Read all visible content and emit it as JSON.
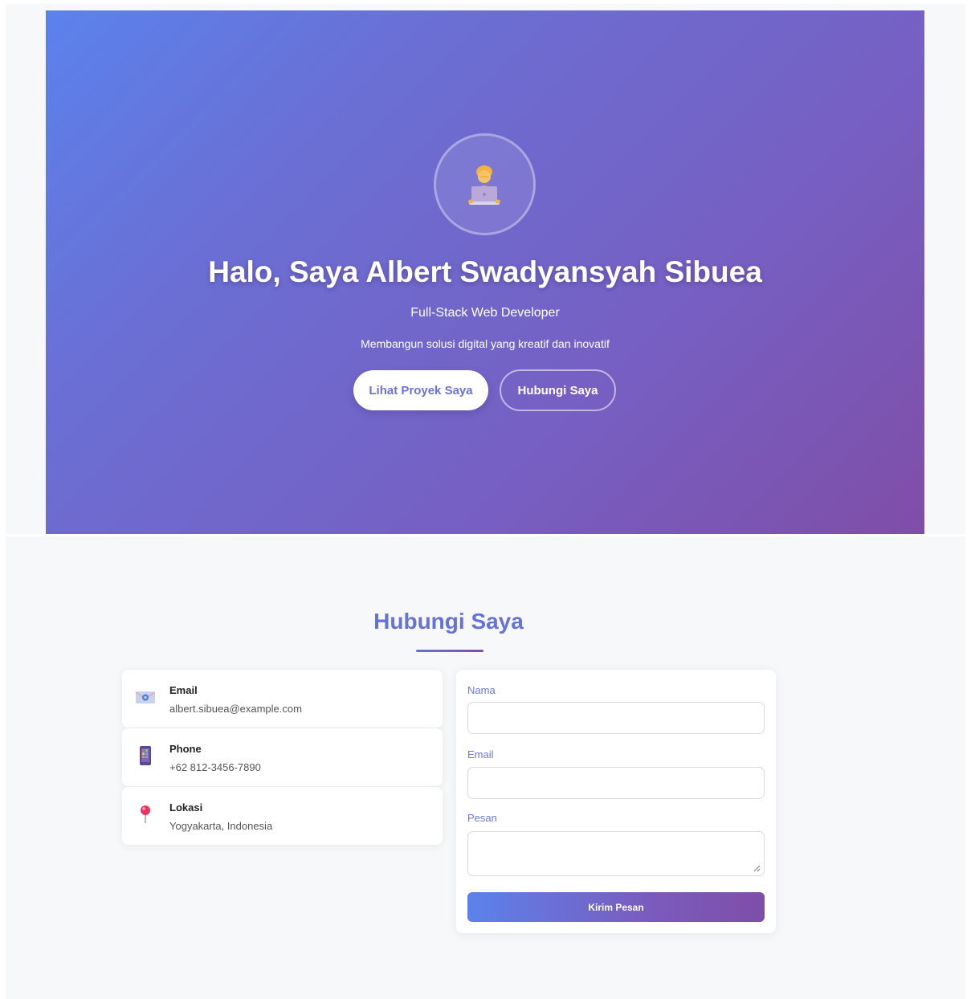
{
  "hero": {
    "avatar_icon": "developer-at-laptop-emoji-icon",
    "title": "Halo, Saya Albert Swadyansyah Sibuea",
    "subtitle": "Full-Stack Web Developer",
    "tagline": "Membangun solusi digital yang kreatif dan inovatif",
    "primary_button": "Lihat Proyek Saya",
    "secondary_button": "Hubungi Saya",
    "gradient_start": "#5b82ec",
    "gradient_end": "#7f4ea8"
  },
  "contact": {
    "title": "Hubungi Saya",
    "info": [
      {
        "icon": "email-envelope-icon",
        "label": "Email",
        "value": "albert.sibuea@example.com"
      },
      {
        "icon": "mobile-phone-icon",
        "label": "Phone",
        "value": "+62 812-3456-7890"
      },
      {
        "icon": "location-pin-icon",
        "label": "Lokasi",
        "value": "Yogyakarta, Indonesia"
      }
    ],
    "form": {
      "name_label": "Nama",
      "name_value": "",
      "email_label": "Email",
      "email_value": "",
      "message_label": "Pesan",
      "message_value": "",
      "submit_label": "Kirim Pesan"
    },
    "accent_color": "#6472d9"
  }
}
